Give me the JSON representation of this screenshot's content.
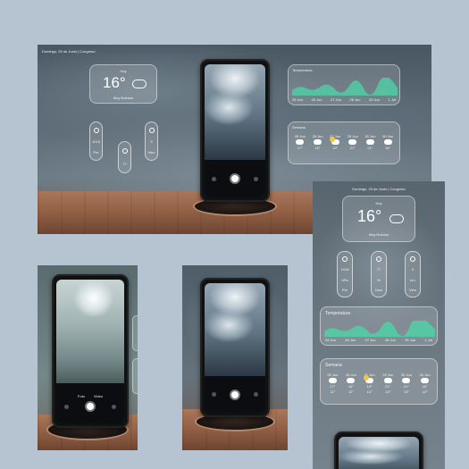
{
  "status_line": "Domingo, 25 de Junio | Congreso",
  "weather": {
    "today_label": "Hoy",
    "temperature": "16°",
    "condition": "Muy Nuboso"
  },
  "metrics": [
    {
      "value": "1016",
      "unit": "hPa",
      "label": "Pre"
    },
    {
      "value": "77",
      "unit": "%",
      "label": "Hum"
    },
    {
      "value": "3",
      "unit": "km",
      "label": "Vien"
    }
  ],
  "temp_card": {
    "title": "Temperatura",
    "days": [
      "25 Jun",
      "26 Jun",
      "27 Jun",
      "28 Jun",
      "29 Jun",
      "1 Jul"
    ]
  },
  "week_card": {
    "title": "Semana",
    "days": [
      "26 Jun",
      "28 Jun",
      "27 Jun",
      "29 Jun",
      "30 Jun",
      "30 Jun"
    ],
    "highs": [
      "17°",
      "16°",
      "19°",
      "21°",
      "21°",
      "18°"
    ],
    "lows": [
      "11°",
      "12°",
      "14°",
      "14°",
      "13°",
      "12°"
    ]
  },
  "camera": {
    "modes": [
      "Foto",
      "Video"
    ]
  },
  "colors": {
    "background": "#b6c4d1",
    "accent_chart": "#4fd1a5",
    "sun": "#f5c542"
  }
}
